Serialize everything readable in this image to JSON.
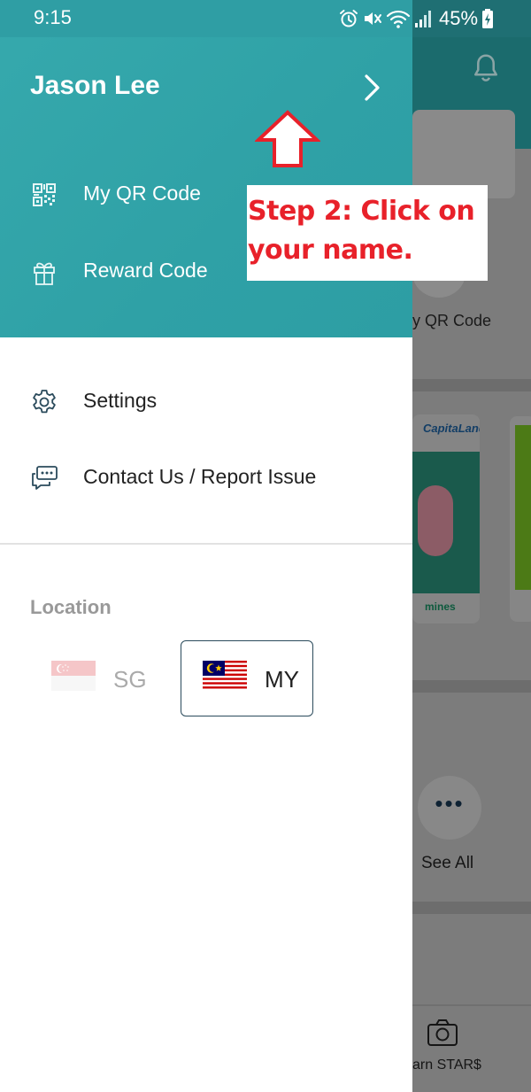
{
  "status_bar": {
    "time": "9:15",
    "battery": "45%",
    "icons": [
      "alarm-icon",
      "mute-icon",
      "wifi-icon",
      "signal-icon",
      "battery-charging-icon"
    ]
  },
  "drawer": {
    "user_name": "Jason Lee",
    "menu_items": [
      {
        "label": "My QR Code",
        "icon": "qr-code-icon"
      },
      {
        "label": "Reward Code",
        "icon": "gift-icon"
      },
      {
        "label": "Settings",
        "icon": "gear-icon"
      },
      {
        "label": "Contact Us / Report Issue",
        "icon": "chat-bubbles-icon"
      }
    ],
    "location": {
      "heading": "Location",
      "options": [
        {
          "code": "SG",
          "flag": "singapore-flag",
          "selected": false
        },
        {
          "code": "MY",
          "flag": "malaysia-flag",
          "selected": true
        }
      ]
    }
  },
  "background": {
    "qr_label": "y QR Code",
    "promo_logo": "CapitaLand",
    "promo_footer": "mines",
    "more_dots": "•••",
    "see_all": "See All",
    "earn_label": "arn STAR$"
  },
  "annotation": {
    "text_line1": "Step 2: Click on",
    "text_line2": "your name.",
    "color": "#e8212a"
  },
  "colors": {
    "header_teal": "#2fa1a6",
    "selected_border": "#2b4b5c"
  }
}
